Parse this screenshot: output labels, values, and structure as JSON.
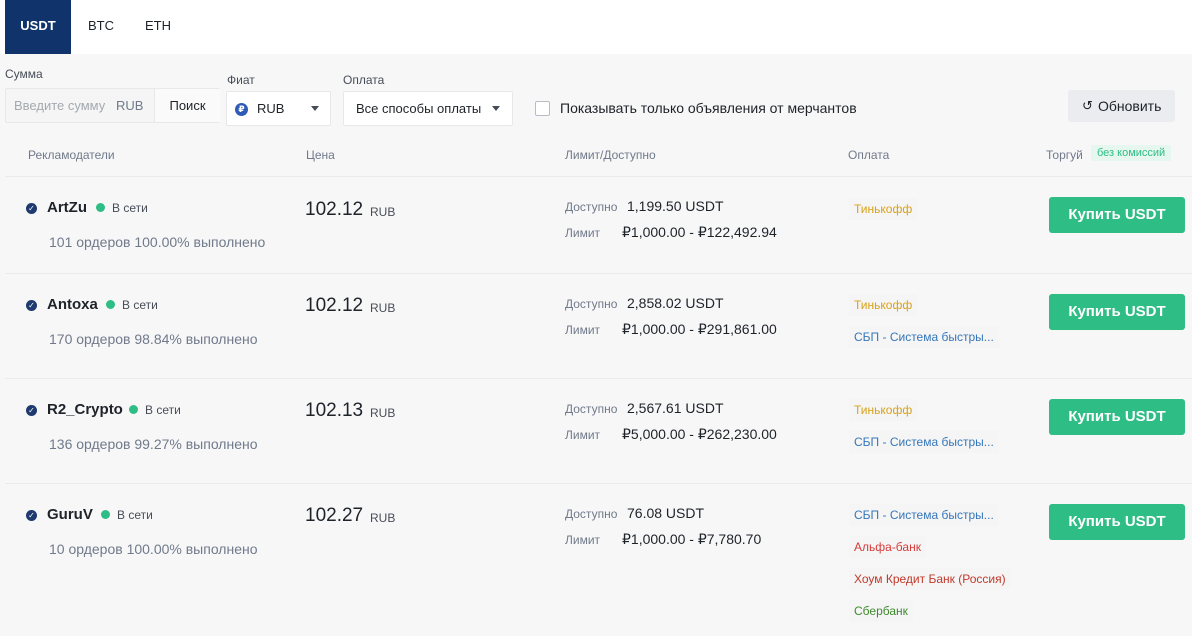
{
  "tabs": [
    {
      "label": "USDT",
      "active": true
    },
    {
      "label": "BTC",
      "active": false
    },
    {
      "label": "ETH",
      "active": false
    }
  ],
  "filters": {
    "amount_label": "Сумма",
    "amount_placeholder": "Введите сумму",
    "amount_currency": "RUB",
    "search_label": "Поиск",
    "fiat_label": "Фиат",
    "fiat_value": "RUB",
    "fiat_icon": "₽",
    "payment_label": "Оплата",
    "payment_value": "Все способы оплаты",
    "merchants_only_label": "Показывать только объявления от мерчантов",
    "merchants_only_checked": false,
    "refresh_label": "Обновить",
    "refresh_icon": "↺"
  },
  "table_header": {
    "advertisers": "Рекламодатели",
    "price": "Цена",
    "limit": "Лимит/Доступно",
    "payment": "Оплата",
    "trade": "Торгуй",
    "no_commission": "без комиссий"
  },
  "labels": {
    "online": "В сети",
    "available": "Доступно",
    "limit": "Лимит",
    "buy": "Купить USDT",
    "verified_icon": "✓"
  },
  "colors": {
    "accent_tab": "#11336b",
    "buy_button": "#2ebd85",
    "online": "#2ebd85",
    "pay_tinkoff": "#d8a31a",
    "pay_sbp": "#3677b9",
    "pay_alfa": "#d63b3b",
    "pay_home": "#c0392b",
    "pay_sber": "#3f8a2e"
  },
  "rows": [
    {
      "name": "ArtZu",
      "orders": "101 ордеров",
      "completion": "100.00% выполнено",
      "price": "102.12",
      "currency": "RUB",
      "available": "1,199.50 USDT",
      "limit": "₽1,000.00 - ₽122,492.94",
      "payments": [
        {
          "label": "Тинькофф",
          "color": "#d8a31a"
        }
      ]
    },
    {
      "name": "Antoxa",
      "orders": "170 ордеров",
      "completion": "98.84% выполнено",
      "price": "102.12",
      "currency": "RUB",
      "available": "2,858.02 USDT",
      "limit": "₽1,000.00 - ₽291,861.00",
      "payments": [
        {
          "label": "Тинькофф",
          "color": "#d8a31a"
        },
        {
          "label": "СБП - Система быстры...",
          "color": "#3677b9"
        }
      ]
    },
    {
      "name": "R2_Crypto",
      "orders": "136 ордеров",
      "completion": "99.27% выполнено",
      "price": "102.13",
      "currency": "RUB",
      "available": "2,567.61 USDT",
      "limit": "₽5,000.00 - ₽262,230.00",
      "payments": [
        {
          "label": "Тинькофф",
          "color": "#d8a31a"
        },
        {
          "label": "СБП - Система быстры...",
          "color": "#3677b9"
        }
      ]
    },
    {
      "name": "GuruV",
      "orders": "10 ордеров",
      "completion": "100.00% выполнено",
      "price": "102.27",
      "currency": "RUB",
      "available": "76.08 USDT",
      "limit": "₽1,000.00 - ₽7,780.70",
      "payments": [
        {
          "label": "СБП - Система быстры...",
          "color": "#3677b9"
        },
        {
          "label": "Альфа-банк",
          "color": "#d63b3b"
        },
        {
          "label": "Хоум Кредит Банк (Россия)",
          "color": "#c0392b"
        },
        {
          "label": "Сбербанк",
          "color": "#3f8a2e"
        }
      ]
    }
  ]
}
